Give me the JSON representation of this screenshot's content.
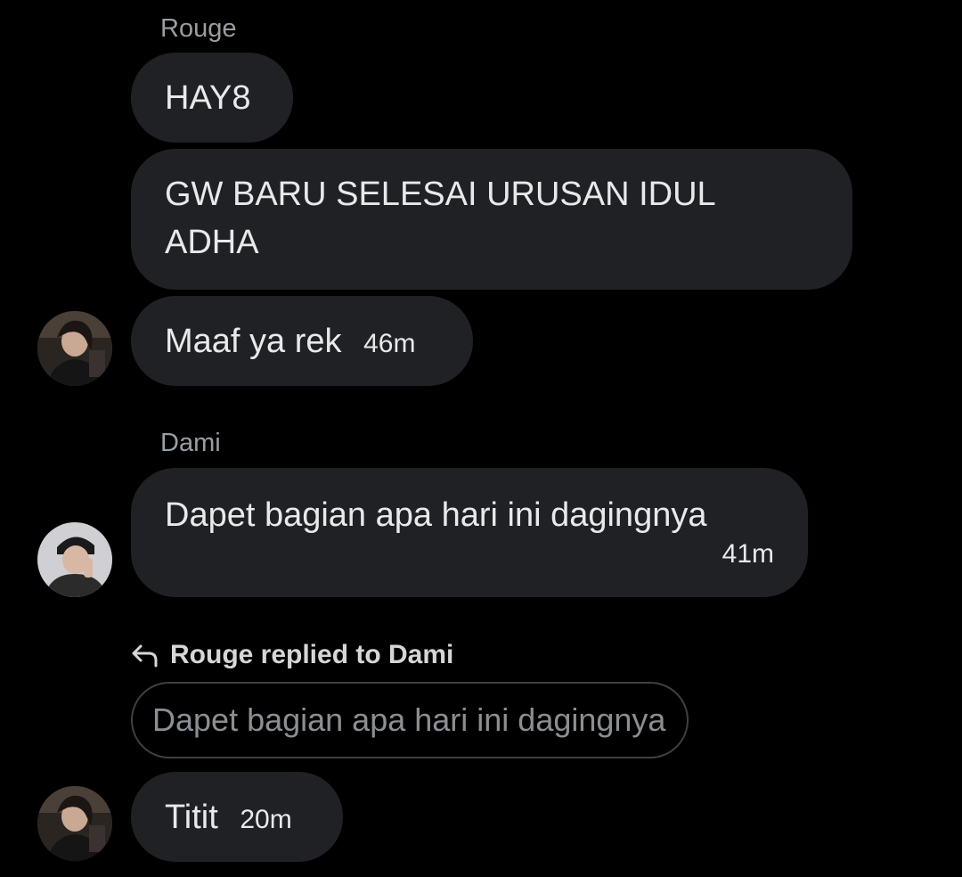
{
  "messages": [
    {
      "sender": "Rouge",
      "bubbles": [
        {
          "text": "HAY8"
        },
        {
          "text": "GW BARU SELESAI URUSAN IDUL ADHA"
        },
        {
          "text": "Maaf ya rek",
          "time": "46m"
        }
      ]
    },
    {
      "sender": "Dami",
      "bubbles": [
        {
          "text": "Dapet bagian apa hari ini dagingnya",
          "time": "41m"
        }
      ]
    },
    {
      "reply_context": "Rouge replied to Dami",
      "quoted_text": "Dapet bagian apa hari ini dagingnya",
      "bubbles": [
        {
          "text": "Titit",
          "time": "20m"
        }
      ]
    }
  ],
  "icons": {
    "reply": "reply-arrow-icon"
  },
  "colors": {
    "background": "#000000",
    "bubble": "#202124",
    "text": "#e7e9ea",
    "muted": "#9a9ea3"
  }
}
